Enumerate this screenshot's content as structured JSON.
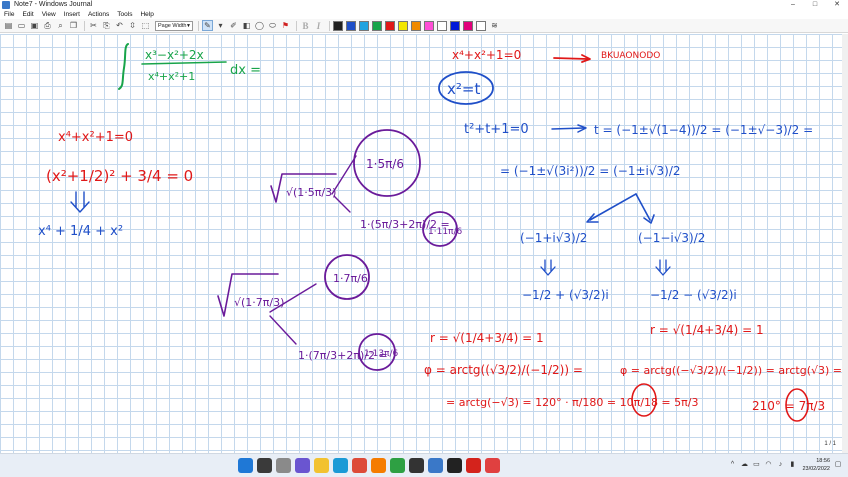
{
  "window": {
    "title": "Note7 - Windows Journal",
    "controls": [
      "–",
      "□",
      "✕"
    ]
  },
  "menu": [
    "File",
    "Edit",
    "View",
    "Insert",
    "Actions",
    "Tools",
    "Help"
  ],
  "toolbar": {
    "view_select": "Page Width",
    "colors": [
      "#202020",
      "#1f4fc8",
      "#1fa3e0",
      "#18a44a",
      "#e01818",
      "#f2e600",
      "#f08a00",
      "#ff4fd6",
      "#ffffff",
      "#0018d8",
      "#e0007a",
      "#ffffff"
    ]
  },
  "page": {
    "page_number": "1 / 1"
  },
  "notes": {
    "integral": "∫ (x³−x²+2x)/(x⁴+x²+1) dx =",
    "red_left_1": "x⁴+x²+1=0",
    "red_left_2": "(x²+1/2)² + 3/4 = 0",
    "blue_left": "x⁴ + 1/4 + x²",
    "top_right_eq": "x⁴+x²+1=0",
    "top_right_word": "BKUAONODO",
    "circled_sub": "x²=t",
    "quad": "t²+t+1=0",
    "t_sol": "t = (−1±√(1−4))/2 = (−1±√−3)/2 =",
    "t_sol_2": "= (−1±√(3i²))/2 = (−1±i√3)/2",
    "root_left": "(−1+i√3)/2",
    "root_right": "(−1−i√3)/2",
    "root_left_simple": "−1/2 + (√3/2)i",
    "root_right_simple": "−1/2 − (√3/2)i",
    "modulus_left": "r = √(1/4+3/4) = 1",
    "modulus_right": "r = √(1/4+3/4) = 1",
    "arg_left_1": "φ = arctg((√3/2)/(−1/2)) =",
    "arg_left_2": "= arctg(−√3) = 120° · π/180 = 10π/18 = 5π/3",
    "arg_right_1": "φ = arctg((−√3/2)/(−1/2)) = arctg(√3) =",
    "arg_right_2": "210° = 7π/3",
    "purple_root1": "√(1·5π/3)",
    "purple_root2": "√(1·7π/3)",
    "purple_c1": "1·5π/6",
    "purple_c2": "1·11π/6",
    "purple_c3": "1·7π/6",
    "purple_c4": "1·13π/6",
    "purple_f1": "1·(5π/3+2π)/2 =",
    "purple_f2": "1·(7π/3+2π)/2 ="
  },
  "taskbar": {
    "time": "18:56",
    "date": "23/02/2022"
  }
}
